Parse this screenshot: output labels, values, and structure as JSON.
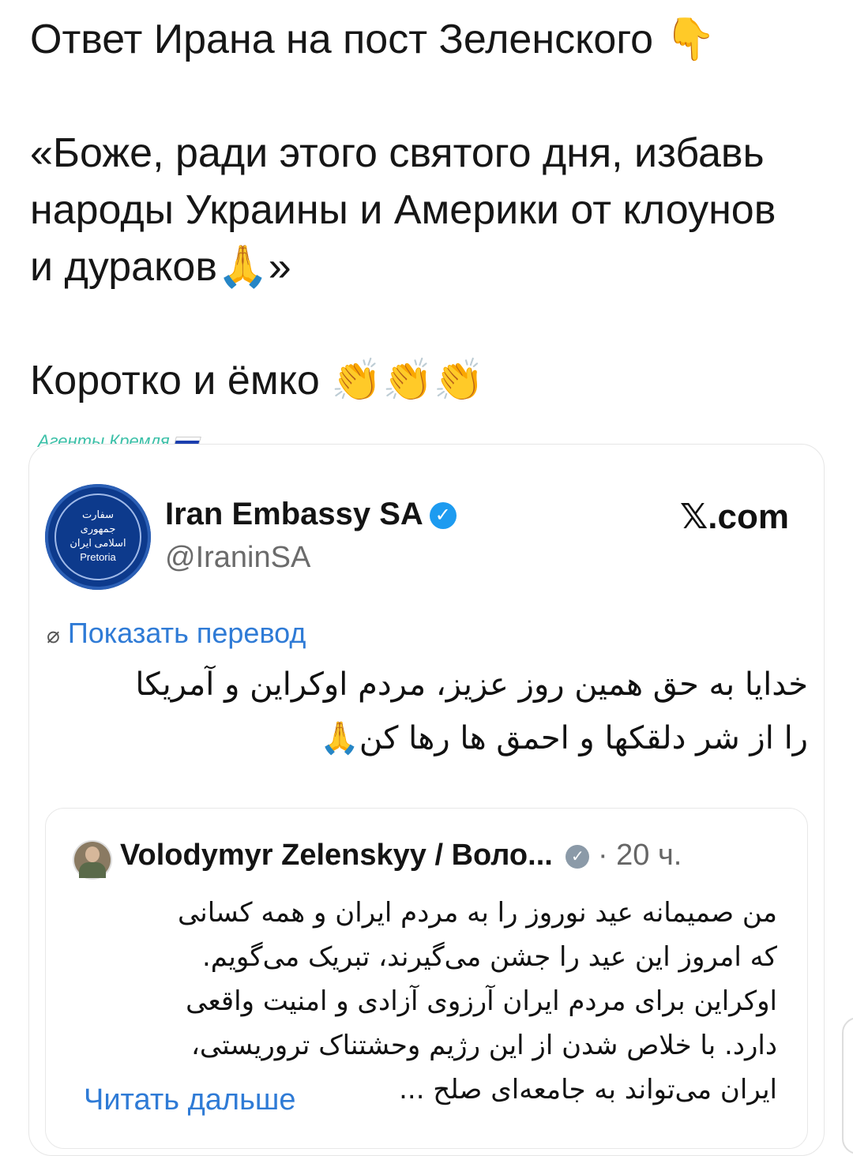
{
  "post": {
    "line1": "Ответ Ирана на пост Зеленского",
    "line1_emoji": "👇",
    "quote_line1": "«Боже, ради этого святого дня, избавь",
    "quote_line2": "народы Украины и Америки от клоунов",
    "quote_line3": "и дураков",
    "quote_line3_emoji": "🙏",
    "quote_line3_end": "»",
    "closing": "Коротко и ёмко",
    "closing_emoji": "👏👏👏"
  },
  "watermark": {
    "text": "Агенты Кремля"
  },
  "tweet": {
    "avatar_icon": "embassy-seal-icon",
    "avatar_text_top": "سفارت",
    "avatar_text_mid": "جمهوری اسلامی ایران",
    "avatar_text_bottom": "Pretoria",
    "author_name": "Iran Embassy SA",
    "author_handle": "@IraninSA",
    "source": "𝕏.com",
    "translate_label": "Показать перевод",
    "text_line1": "خدایا به حق همین روز عزیز، مردم اوکراین و آمریکا",
    "text_line2": "را از شر دلقکها و احمق ها رها کن🙏"
  },
  "quoted": {
    "author_name": "Volodymyr Zelenskyy / Воло...",
    "time": "· 20 ч.",
    "line1": "من صمیمانه عید نوروز را به مردم ایران و همه کسانی",
    "line2": "که امروز این عید را جشن می‌گیرند، تبریک می‌گویم.",
    "line3": "اوکراین برای مردم ایران آرزوی آزادی و امنیت واقعی",
    "line4": "دارد. با خلاص شدن از این رژیم وحشتناک تروریستی،",
    "line5": "ایران می‌تواند به جامعه‌ای صلح ...",
    "read_more": "Читать дальше"
  },
  "colors": {
    "link": "#2f7bd6",
    "verified": "#1d9bf0",
    "watermark": "#3cc0a8"
  }
}
